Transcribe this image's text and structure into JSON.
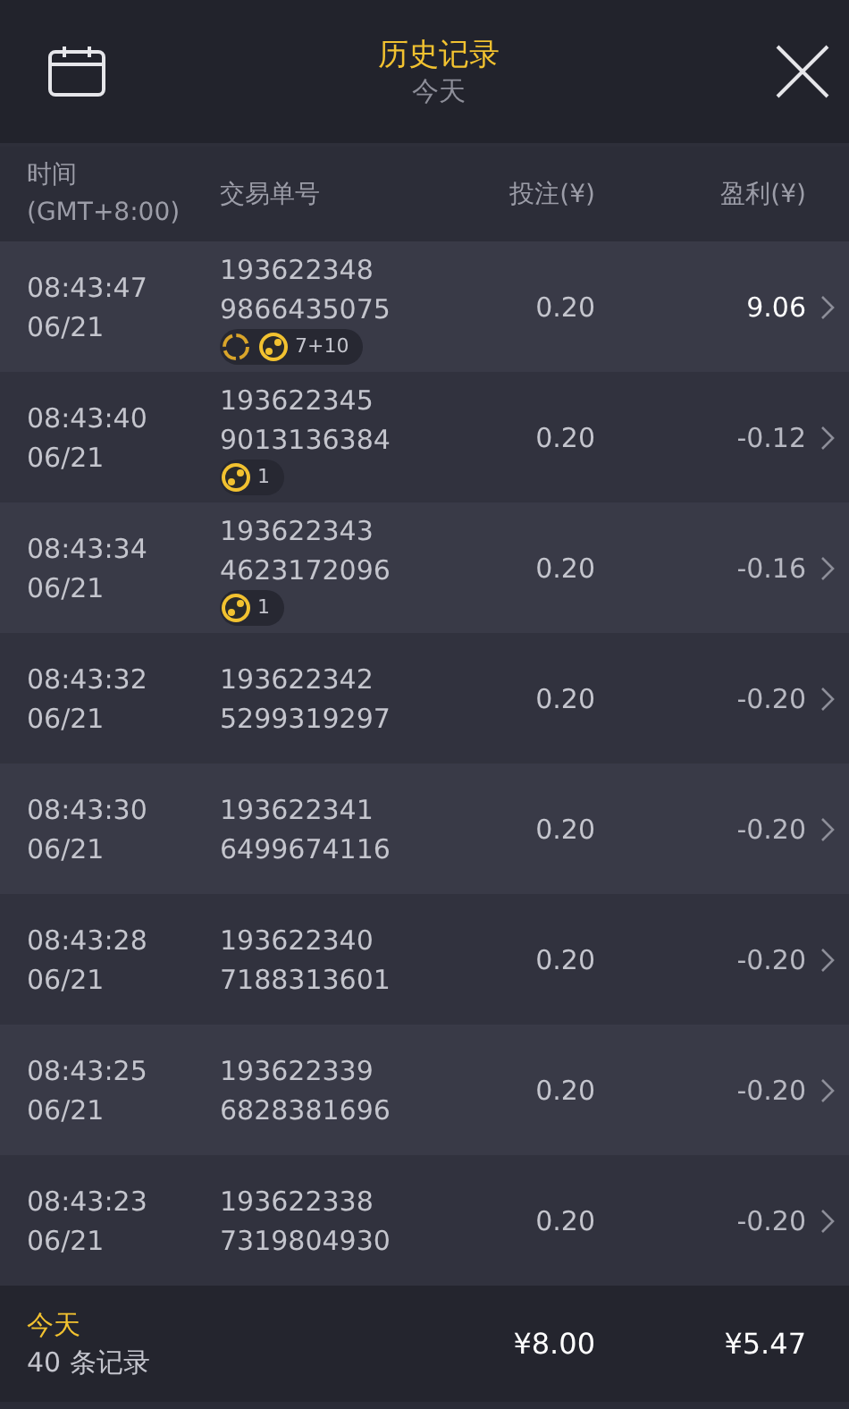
{
  "header": {
    "title": "历史记录",
    "subtitle": "今天"
  },
  "columns": {
    "time": [
      "时间",
      "(GMT+8:00)"
    ],
    "order": "交易单号",
    "bet": "投注(¥)",
    "profit": "盈利(¥)"
  },
  "rows": [
    {
      "time": "08:43:47",
      "date": "06/21",
      "order": [
        "193622348",
        "9866435075"
      ],
      "bet": "0.20",
      "profit": "9.06",
      "win": true,
      "badge": {
        "icons": [
          {
            "kind": "spin"
          },
          {
            "kind": "ball"
          }
        ],
        "text": "7+10"
      }
    },
    {
      "time": "08:43:40",
      "date": "06/21",
      "order": [
        "193622345",
        "9013136384"
      ],
      "bet": "0.20",
      "profit": "-0.12",
      "win": false,
      "badge": {
        "icons": [
          {
            "kind": "ball"
          }
        ],
        "text": "1"
      }
    },
    {
      "time": "08:43:34",
      "date": "06/21",
      "order": [
        "193622343",
        "4623172096"
      ],
      "bet": "0.20",
      "profit": "-0.16",
      "win": false,
      "badge": {
        "icons": [
          {
            "kind": "ball"
          }
        ],
        "text": "1"
      }
    },
    {
      "time": "08:43:32",
      "date": "06/21",
      "order": [
        "193622342",
        "5299319297"
      ],
      "bet": "0.20",
      "profit": "-0.20",
      "win": false
    },
    {
      "time": "08:43:30",
      "date": "06/21",
      "order": [
        "193622341",
        "6499674116"
      ],
      "bet": "0.20",
      "profit": "-0.20",
      "win": false
    },
    {
      "time": "08:43:28",
      "date": "06/21",
      "order": [
        "193622340",
        "7188313601"
      ],
      "bet": "0.20",
      "profit": "-0.20",
      "win": false
    },
    {
      "time": "08:43:25",
      "date": "06/21",
      "order": [
        "193622339",
        "6828381696"
      ],
      "bet": "0.20",
      "profit": "-0.20",
      "win": false
    },
    {
      "time": "08:43:23",
      "date": "06/21",
      "order": [
        "193622338",
        "7319804930"
      ],
      "bet": "0.20",
      "profit": "-0.20",
      "win": false
    }
  ],
  "footer": {
    "period": "今天",
    "count": "40 条记录",
    "bet_total": "¥8.00",
    "profit_total": "¥5.47"
  }
}
